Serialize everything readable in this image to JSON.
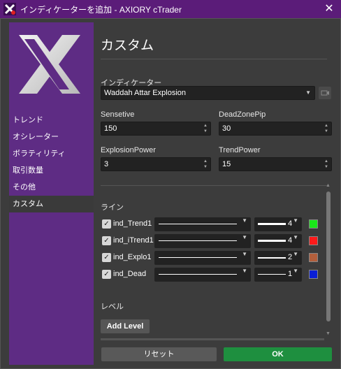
{
  "window": {
    "title": "インディケーターを追加 - AXIORY cTrader",
    "close_label": "✕"
  },
  "sidebar": {
    "items": [
      {
        "label": "トレンド"
      },
      {
        "label": "オシレーター"
      },
      {
        "label": "ボラティリティ"
      },
      {
        "label": "取引数量"
      },
      {
        "label": "その他"
      },
      {
        "label": "カスタム",
        "active": true
      }
    ]
  },
  "main": {
    "heading": "カスタム",
    "indicator_label": "インディケーター",
    "indicator_value": "Waddah Attar Explosion",
    "params": {
      "sensetive_label": "Sensetive",
      "sensetive_value": "150",
      "deadzone_label": "DeadZonePip",
      "deadzone_value": "30",
      "explosion_label": "ExplosionPower",
      "explosion_value": "3",
      "trend_label": "TrendPower",
      "trend_value": "15"
    },
    "lines_label": "ライン",
    "lines": [
      {
        "name": "ind_Trend1",
        "width": "4",
        "color": "#19e619"
      },
      {
        "name": "ind_iTrend1",
        "width": "4",
        "color": "#ff1a1a"
      },
      {
        "name": "ind_Explo1",
        "width": "2",
        "color": "#b35f3c"
      },
      {
        "name": "ind_Dead",
        "width": "1",
        "color": "#0a1fd6"
      }
    ],
    "levels_label": "レベル",
    "add_level_label": "Add Level"
  },
  "footer": {
    "reset_label": "リセット",
    "ok_label": "OK"
  },
  "colors": {
    "titlebar": "#5b1c79",
    "sidebar": "#5e2c84",
    "ok_button": "#1e8f3f"
  }
}
